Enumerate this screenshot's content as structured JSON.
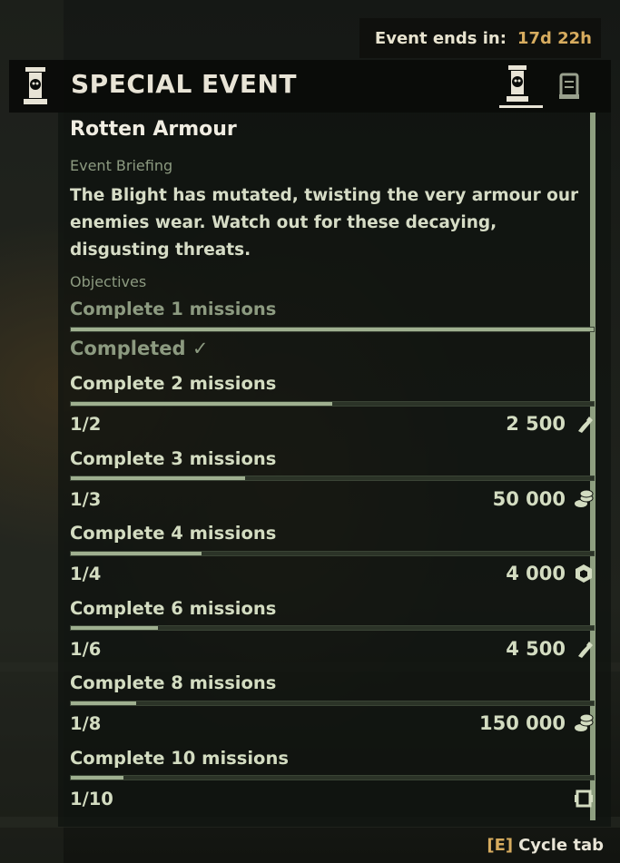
{
  "timer": {
    "label": "Event ends in:",
    "value": "17d 22h"
  },
  "header": {
    "title": "SPECIAL EVENT"
  },
  "event": {
    "name": "Rotten Armour",
    "briefing_label": "Event Briefing",
    "briefing": "The Blight has mutated, twisting the very armour our enemies wear. Watch out for these decaying, disgusting threats."
  },
  "objectives": {
    "label": "Objectives",
    "items": [
      {
        "title": "Complete 1 missions",
        "progress": 1.0,
        "status": "Completed ✓"
      },
      {
        "title": "Complete 2 missions",
        "progress": 0.5,
        "count": "1/2",
        "reward": "2 500",
        "reward_icon": "ticket-icon"
      },
      {
        "title": "Complete 3 missions",
        "progress": 0.3333,
        "count": "1/3",
        "reward": "50 000",
        "reward_icon": "coins-icon"
      },
      {
        "title": "Complete 4 missions",
        "progress": 0.25,
        "count": "1/4",
        "reward": "4 000",
        "reward_icon": "plasteel-icon"
      },
      {
        "title": "Complete 6 missions",
        "progress": 0.1667,
        "count": "1/6",
        "reward": "4 500",
        "reward_icon": "ticket-icon"
      },
      {
        "title": "Complete 8 missions",
        "progress": 0.125,
        "count": "1/8",
        "reward": "150 000",
        "reward_icon": "coins-icon"
      },
      {
        "title": "Complete 10 missions",
        "progress": 0.1,
        "count": "1/10",
        "reward": "",
        "reward_icon": "cosmetic-icon"
      }
    ]
  },
  "footer": {
    "key": "[E]",
    "label": "Cycle tab"
  },
  "colors": {
    "accent": "#d7ac5f",
    "bar_fill": "#9fb090",
    "text": "#d3dcc1",
    "muted": "#8c9a80"
  }
}
